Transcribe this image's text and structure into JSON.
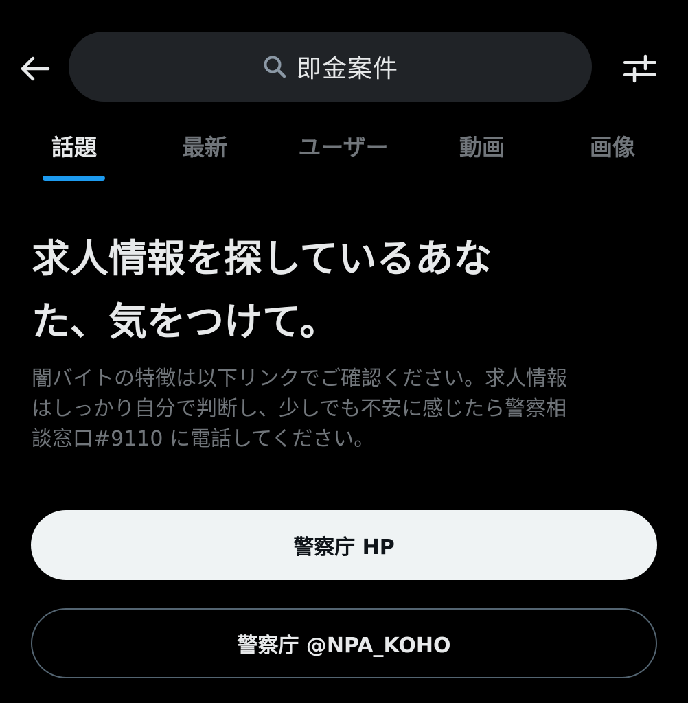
{
  "header": {
    "back_icon": "arrow-left-icon",
    "search_icon": "search-icon",
    "search_query": "即金案件",
    "filter_icon": "sliders-icon"
  },
  "tabs": [
    {
      "label": "話題",
      "active": true
    },
    {
      "label": "最新",
      "active": false
    },
    {
      "label": "ユーザー",
      "active": false
    },
    {
      "label": "動画",
      "active": false
    },
    {
      "label": "画像",
      "active": false
    }
  ],
  "notice": {
    "headline_line1": "求人情報を探しているあな",
    "headline_line2": "た、気をつけて。",
    "body_line1": "闇バイトの特徴は以下リンクでご確認ください。求人情報",
    "body_line2": "はしっかり自分で判断し、少しでも不安に感じたら警察相",
    "body_line3": "談窓口#9110 に電話してください。"
  },
  "buttons": {
    "primary_label": "警察庁 HP",
    "secondary_label": "警察庁 @NPA_KOHO"
  },
  "colors": {
    "background": "#000000",
    "accent": "#1d9bf0",
    "search_bg": "#202327",
    "muted_text": "#71767b"
  }
}
